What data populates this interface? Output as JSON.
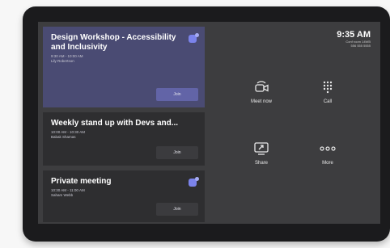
{
  "clock": {
    "time": "9:35 AM",
    "room": "Conf room 14WB",
    "number": "556 555 5555"
  },
  "meetings": [
    {
      "title": "Design Workshop - Accessibility and Inclusivity",
      "time": "9:30 AM - 10:00 AM",
      "organizer": "Lily Robertson",
      "join_label": "Join"
    },
    {
      "title": "Weekly stand up with Devs and...",
      "time": "10:00 AM - 10:30 AM",
      "organizer": "Babak Shamas",
      "join_label": "Join"
    },
    {
      "title": "Private meeting",
      "time": "10:30 AM - 11:00 AM",
      "organizer": "Saham Webb",
      "join_label": "Join"
    }
  ],
  "actions": {
    "meet_now": "Meet now",
    "call": "Call",
    "share": "Share",
    "more": "More"
  },
  "icons": {
    "meet_now": "video-camera-icon",
    "call": "dialpad-icon",
    "share": "share-screen-icon",
    "more": "more-dots-icon",
    "teams": "teams-icon"
  },
  "colors": {
    "screen_bg": "#3d3d3f",
    "featured_card": "#4a4b73",
    "card": "#2e2e30",
    "accent": "#6264a7",
    "teams_icon": "#7b83eb"
  }
}
